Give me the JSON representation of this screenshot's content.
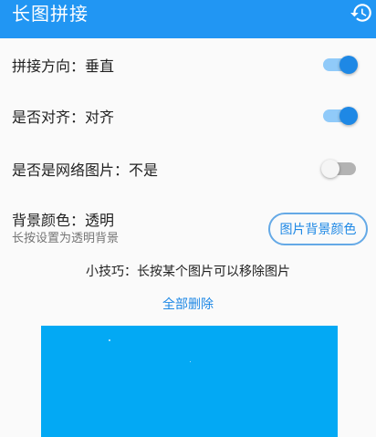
{
  "app_bar": {
    "title": "长图拼接",
    "history_icon": "history-icon",
    "color": "#2196f3"
  },
  "settings": {
    "direction": {
      "label": "拼接方向：垂直",
      "enabled": true
    },
    "align": {
      "label": "是否对齐：对齐",
      "enabled": true
    },
    "network_image": {
      "label": "是否是网络图片：不是",
      "enabled": false
    }
  },
  "background": {
    "label": "背景颜色：透明",
    "hint": "长按设置为透明背景",
    "button_label": "图片背景颜色"
  },
  "tip": "小技巧：长按某个图片可以移除图片",
  "delete_all_label": "全部删除",
  "colors": {
    "accent": "#1e88e5",
    "preview_background": "#03a9f4"
  }
}
